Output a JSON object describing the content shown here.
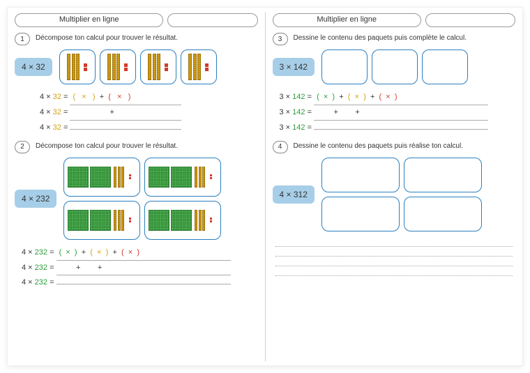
{
  "left": {
    "title": "Multiplier en ligne",
    "ex1": {
      "num": "1",
      "instr": "Décompose ton calcul pour trouver le résultat.",
      "problem": "4 × 32",
      "lines": {
        "a_prefix": "4 × ",
        "a_op": "32",
        "a_eq": " =",
        "b_prefix": "4 × ",
        "b_op": "32",
        "b_eq": " =",
        "c_prefix": "4 × ",
        "c_op": "32",
        "c_eq": " =",
        "paren_open1": "(",
        "x1": "×",
        "paren_close1": ")",
        "plus": "+",
        "paren_open2": "(",
        "x2": "×",
        "paren_close2": ")"
      }
    },
    "ex2": {
      "num": "2",
      "instr": "Décompose ton calcul pour trouver le résultat.",
      "problem": "4 × 232",
      "lines": {
        "a_prefix": "4 × ",
        "a_op": "232",
        "a_eq": " =",
        "b_prefix": "4 × ",
        "b_op": "232",
        "b_eq": " =",
        "c_prefix": "4 × ",
        "c_op": "232",
        "c_eq": " =",
        "paren_o1": "(",
        "x1": "×",
        "paren_c1": ")",
        "plus1": "+",
        "paren_o2": "(",
        "x2": "×",
        "paren_c2": ")",
        "plus2": "+",
        "paren_o3": "(",
        "x3": "×",
        "paren_c3": ")"
      }
    }
  },
  "right": {
    "title": "Multiplier en ligne",
    "ex3": {
      "num": "3",
      "instr": "Dessine le contenu des paquets puis complète le calcul.",
      "problem": "3 × 142",
      "lines": {
        "a_prefix": "3 × ",
        "a_op": "142",
        "a_eq": " =",
        "b_prefix": "3 × ",
        "b_op": "142",
        "b_eq": " =",
        "c_prefix": "3 × ",
        "c_op": "142",
        "c_eq": " =",
        "paren_o1": "(",
        "x1": "×",
        "paren_c1": ")",
        "plus1": "+",
        "paren_o2": "(",
        "x2": "×",
        "paren_c2": ")",
        "plus2": "+",
        "paren_o3": "(",
        "x3": "×",
        "paren_c3": ")"
      }
    },
    "ex4": {
      "num": "4",
      "instr": "Dessine le contenu des paquets puis réalise ton calcul.",
      "problem": "4 × 312"
    }
  }
}
